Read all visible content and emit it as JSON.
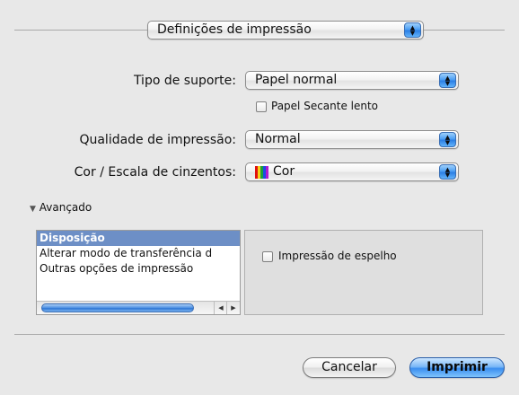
{
  "panel_selector": {
    "value": "Definições de impressão"
  },
  "form": {
    "media_type": {
      "label": "Tipo de suporte:",
      "value": "Papel normal"
    },
    "slow_dry": {
      "label": "Papel Secante lento",
      "checked": false
    },
    "quality": {
      "label": "Qualidade de impressão:",
      "value": "Normal"
    },
    "color": {
      "label": "Cor / Escala de cinzentos:",
      "value": "Cor"
    }
  },
  "advanced": {
    "toggle_label": "Avançado",
    "expanded": true,
    "list_items": [
      "Disposição",
      "Alterar modo de transferência d",
      "Outras opções de impressão"
    ],
    "selected_index": 0,
    "mirror_print": {
      "label": "Impressão de espelho",
      "checked": false
    }
  },
  "buttons": {
    "cancel": "Cancelar",
    "print": "Imprimir"
  },
  "colors": {
    "accent": "#3b8ef0",
    "selection": "#6d8fc6"
  }
}
